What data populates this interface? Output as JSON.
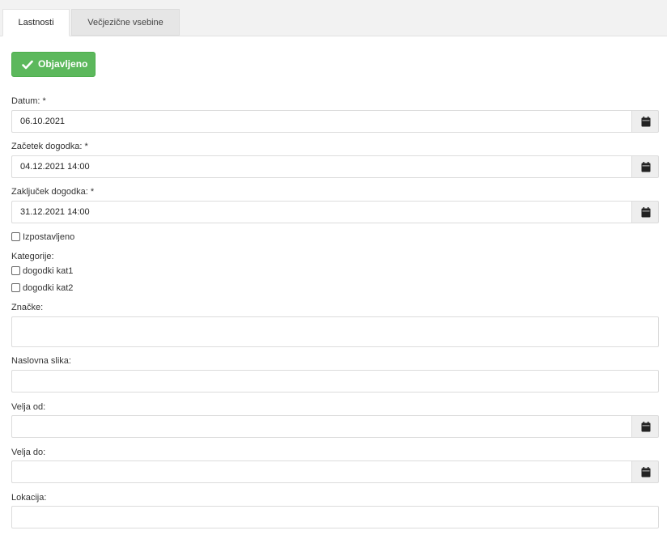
{
  "tabs": [
    {
      "label": "Lastnosti",
      "active": true
    },
    {
      "label": "Večjezične vsebine",
      "active": false
    }
  ],
  "status_button": {
    "label": "Objavljeno",
    "icon": "check-icon",
    "color": "#5cb85c"
  },
  "fields": {
    "datum": {
      "label": "Datum: *",
      "value": "06.10.2021"
    },
    "zacetek": {
      "label": "Začetek dogodka: *",
      "value": "04.12.2021 14:00"
    },
    "zakljucek": {
      "label": "Zaključek dogodka: *",
      "value": "31.12.2021 14:00"
    },
    "izpostavljeno": {
      "label": "Izpostavljeno",
      "checked": false
    },
    "kategorije": {
      "label": "Kategorije:",
      "options": [
        {
          "label": "dogodki kat1",
          "checked": false
        },
        {
          "label": "dogodki kat2",
          "checked": false
        }
      ]
    },
    "znacke": {
      "label": "Značke:",
      "value": ""
    },
    "naslovna_slika": {
      "label": "Naslovna slika:",
      "value": ""
    },
    "velja_od": {
      "label": "Velja od:",
      "value": ""
    },
    "velja_do": {
      "label": "Velja do:",
      "value": ""
    },
    "lokacija": {
      "label": "Lokacija:",
      "value": ""
    }
  },
  "icons": {
    "calendar": "calendar-icon"
  }
}
